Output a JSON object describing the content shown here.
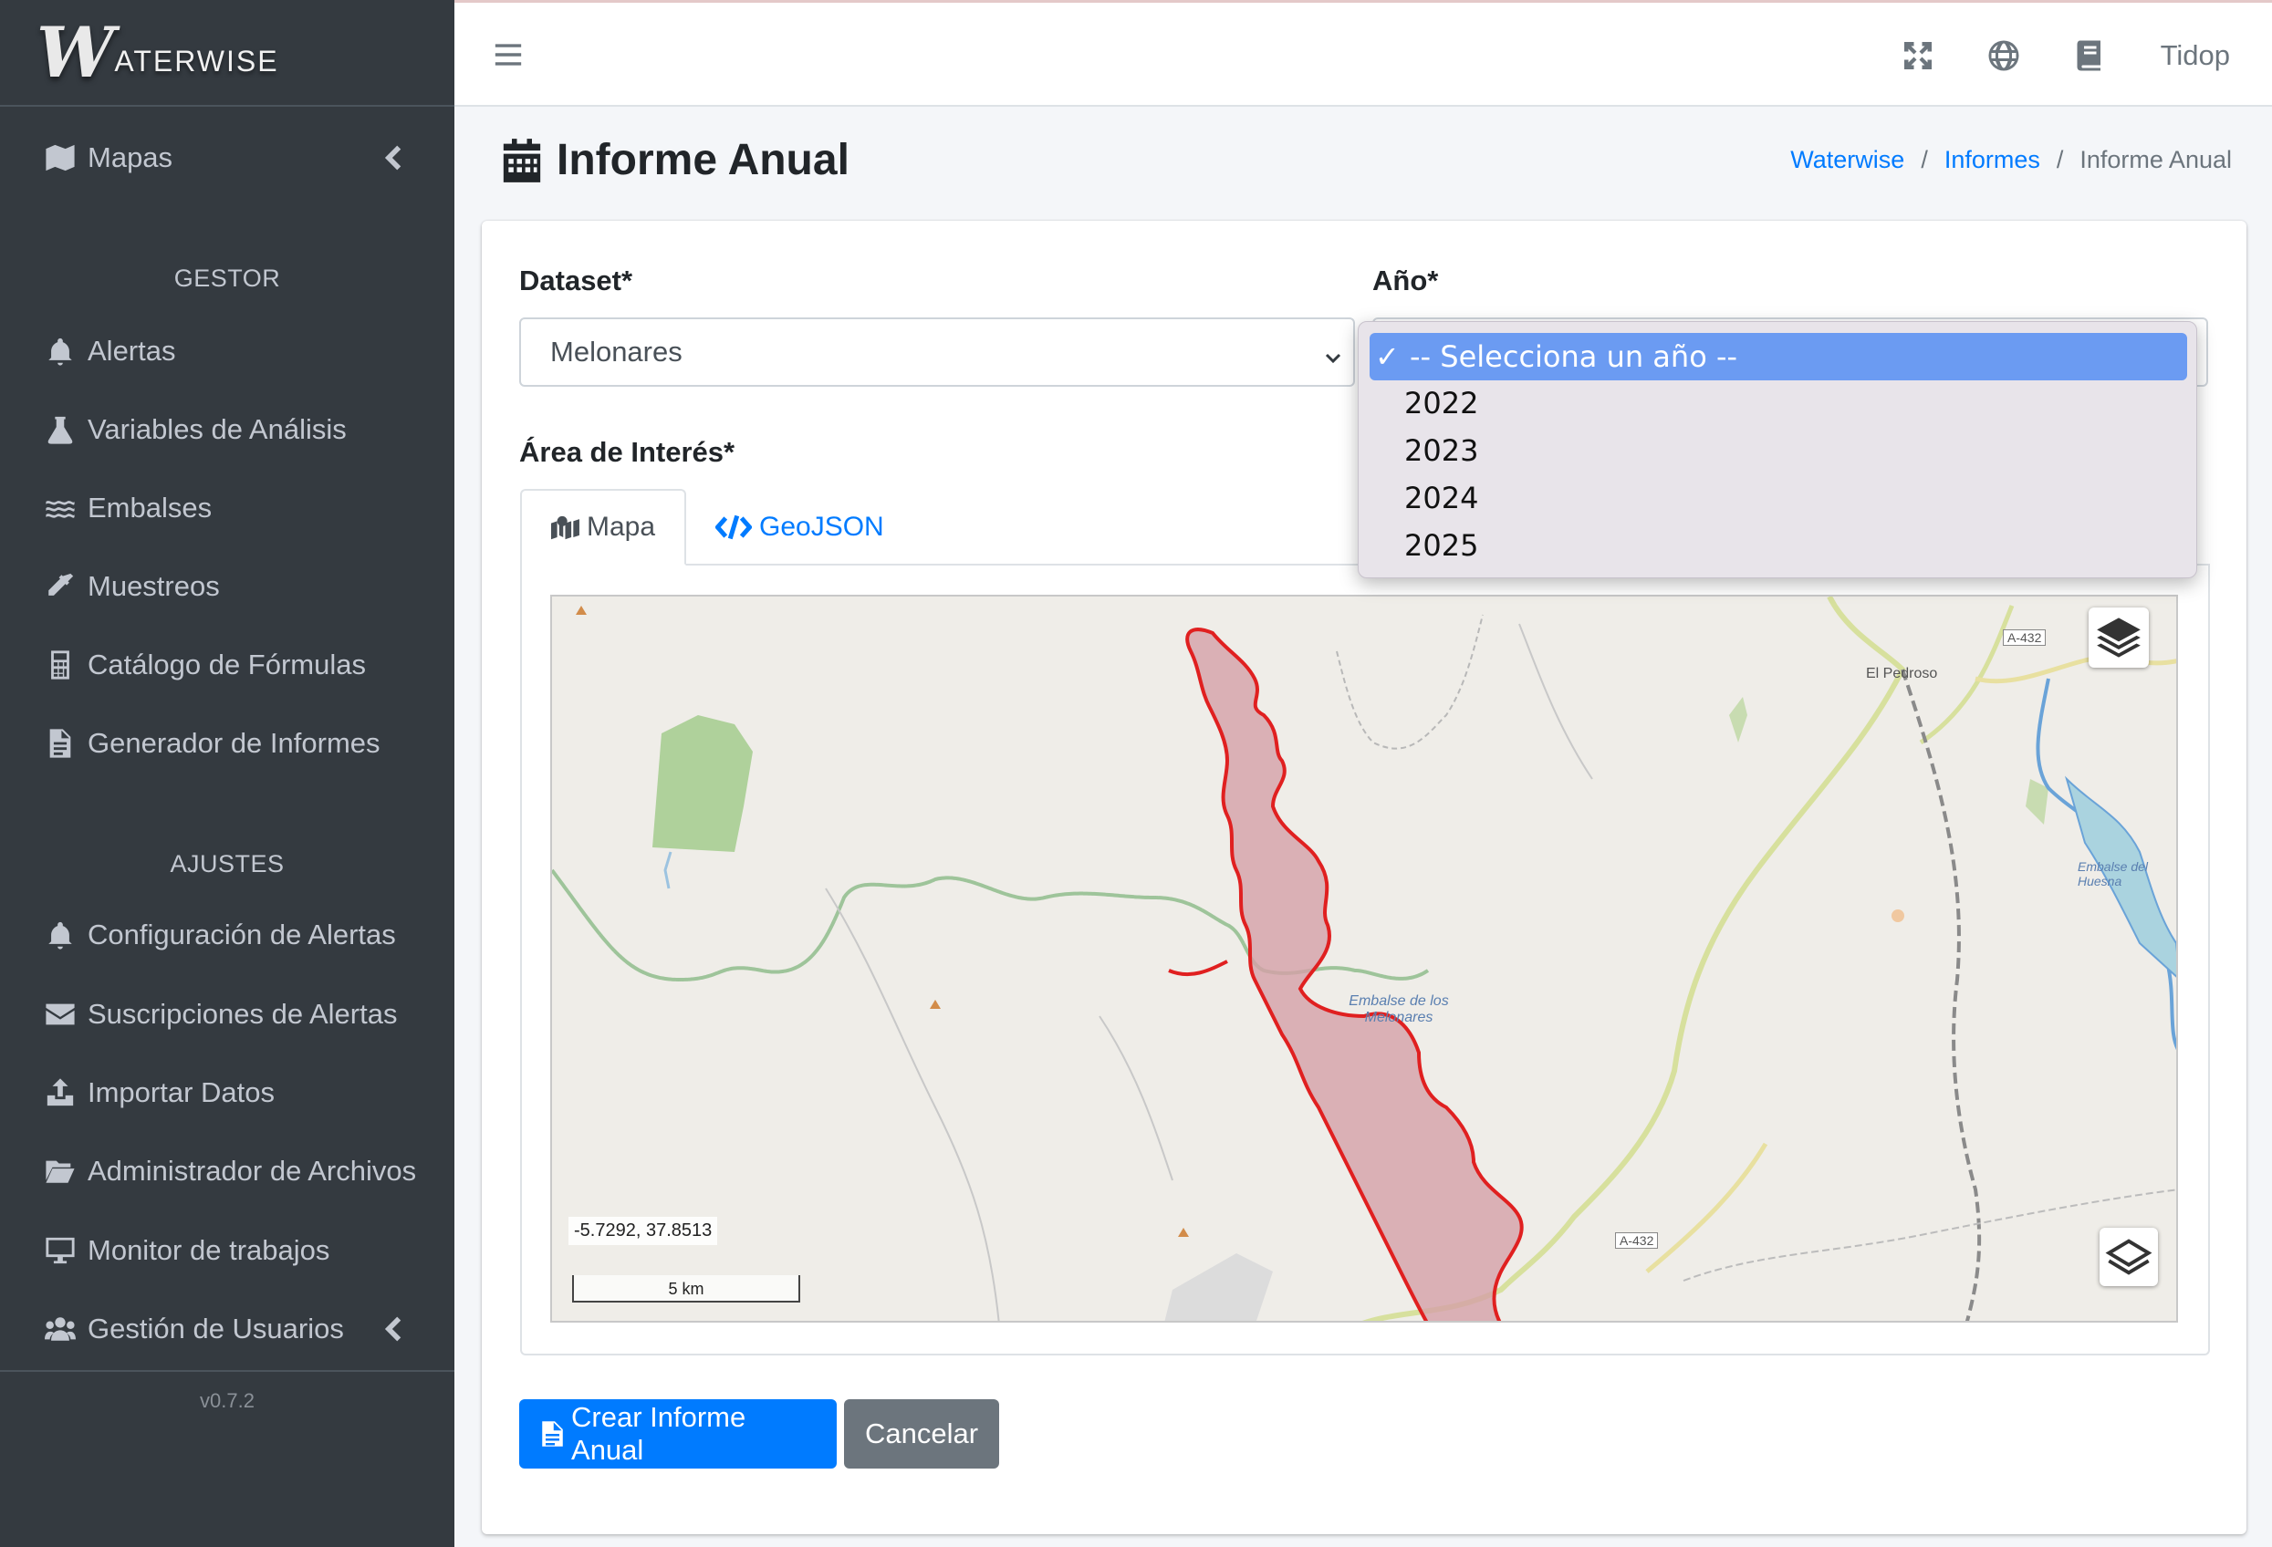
{
  "brand": {
    "initial": "W",
    "name": "ATERWISE"
  },
  "sidebar": {
    "items_top": [
      {
        "label": "Mapas",
        "icon": "map-icon"
      }
    ],
    "section_gestor": "GESTOR",
    "gestor_items": [
      {
        "label": "Alertas",
        "icon": "bell-icon"
      },
      {
        "label": "Variables de Análisis",
        "icon": "flask-icon"
      },
      {
        "label": "Embalses",
        "icon": "water-icon"
      },
      {
        "label": "Muestreos",
        "icon": "eyedropper-icon"
      },
      {
        "label": "Catálogo de Fórmulas",
        "icon": "calculator-icon"
      },
      {
        "label": "Generador de Informes",
        "icon": "file-icon"
      }
    ],
    "section_ajustes": "AJUSTES",
    "ajustes_items": [
      {
        "label": "Configuración de Alertas",
        "icon": "bell-icon"
      },
      {
        "label": "Suscripciones de Alertas",
        "icon": "envelope-icon"
      },
      {
        "label": "Importar Datos",
        "icon": "upload-icon"
      },
      {
        "label": "Administrador de Archivos",
        "icon": "folder-open-icon"
      },
      {
        "label": "Monitor de trabajos",
        "icon": "desktop-icon"
      },
      {
        "label": "Gestión de Usuarios",
        "icon": "users-icon"
      }
    ],
    "version": "v0.7.2"
  },
  "topbar": {
    "user": "Tidop",
    "icons": [
      "expand-icon",
      "globe-icon",
      "book-icon"
    ]
  },
  "page": {
    "title": "Informe Anual",
    "breadcrumb": [
      "Waterwise",
      "Informes",
      "Informe Anual"
    ]
  },
  "form": {
    "dataset_label": "Dataset*",
    "dataset_value": "Melonares",
    "year_label": "Año*",
    "year_options": [
      "-- Selecciona un año --",
      "2022",
      "2023",
      "2024",
      "2025"
    ],
    "year_selected": "-- Selecciona un año --",
    "aoi_label": "Área de Interés*",
    "tabs": [
      "Mapa",
      "GeoJSON"
    ],
    "active_tab": "Mapa"
  },
  "map": {
    "coords": "-5.7292, 37.8513",
    "scale": "5 km",
    "labels": {
      "town": "El Pedroso",
      "road1": "A-432",
      "road2": "A-432",
      "reservoir": "Embalse de los Melonares",
      "reservoir2": "Embalse del Huesna"
    },
    "polygon_color": "#e02020",
    "polygon_fill": "#d4a0a8"
  },
  "buttons": {
    "create": "Crear Informe Anual",
    "cancel": "Cancelar"
  },
  "colors": {
    "sidebar_bg": "#343a40",
    "primary": "#007bff",
    "secondary": "#6c757d",
    "dropdown_highlight": "#6b9bf2"
  }
}
